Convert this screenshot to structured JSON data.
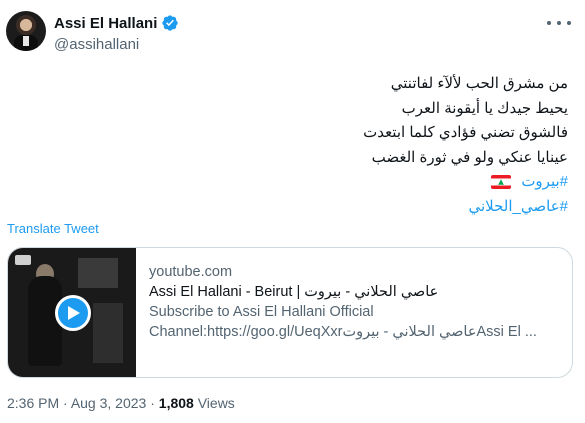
{
  "author": {
    "display_name": "Assi El Hallani",
    "handle": "@assihallani"
  },
  "tweet": {
    "lines": [
      "من مشرق الحب لألآء لفاتنتي",
      "يحيط جيدك يا أيقونة العرب",
      "فالشوق تضني فؤادي كلما ابتعدت",
      "عينايا عنكي ولو في ثورة الغضب"
    ],
    "hashtag_1": "#بيروت",
    "hashtag_2": "#عاصي_الحلاني",
    "flag_icon": "lebanon-flag-icon"
  },
  "translate_label": "Translate Tweet",
  "card": {
    "domain": "youtube.com",
    "title": "Assi El Hallani - Beirut | عاصي الحلاني - بيروت",
    "desc_1": "Subscribe to Assi El Hallani Official",
    "desc_2": "Channel:https://goo.gl/UeqXxrعاصي الحلاني - بيروتAssi El ..."
  },
  "meta": {
    "time": "2:36 PM",
    "sep": " · ",
    "date": "Aug 3, 2023",
    "views_count": "1,808",
    "views_label": " Views"
  },
  "colors": {
    "accent": "#1d9bf0",
    "secondary_text": "#536471",
    "primary_text": "#0f1419"
  }
}
